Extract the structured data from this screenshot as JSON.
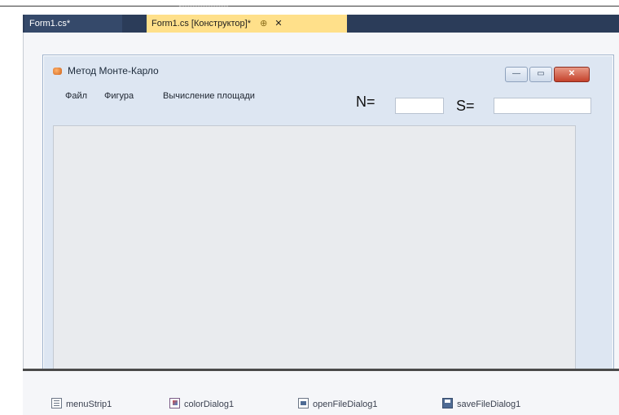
{
  "ide": {
    "tabs": [
      {
        "label": "Form1.cs*"
      },
      {
        "label": "Form1.cs [Конструктор]*",
        "pin_glyph": "⊕",
        "close_glyph": "✕"
      }
    ]
  },
  "form": {
    "title": "Метод Монте-Карло",
    "window_buttons": {
      "minimize": "—",
      "maximize": "▭",
      "close": "✕"
    },
    "menu": [
      "Файл",
      "Фигура",
      "Вычисление площади"
    ],
    "n_label": "N=",
    "s_label": "S=",
    "n_value": "",
    "s_value": ""
  },
  "tray": {
    "components": [
      {
        "label": "menuStrip1",
        "icon": "menu-strip-icon"
      },
      {
        "label": "colorDialog1",
        "icon": "color-dialog-icon"
      },
      {
        "label": "openFileDialog1",
        "icon": "open-file-dialog-icon"
      },
      {
        "label": "saveFileDialog1",
        "icon": "save-file-dialog-icon"
      }
    ]
  }
}
